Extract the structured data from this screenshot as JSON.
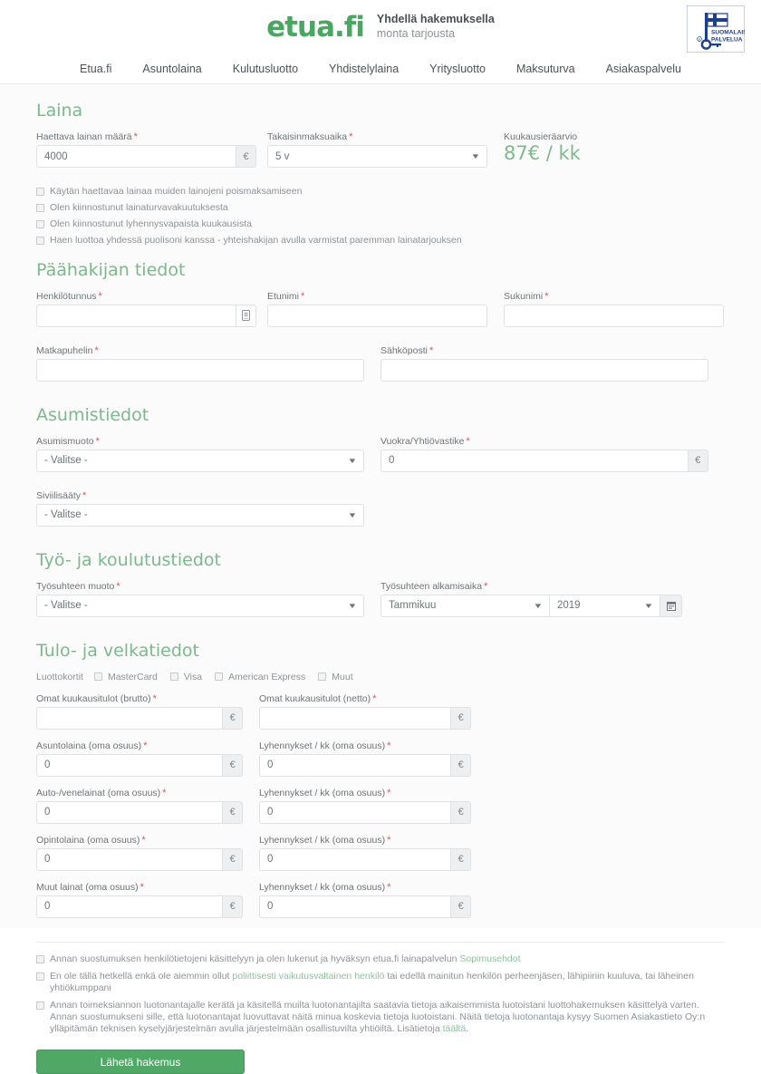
{
  "header": {
    "logo_text": "etua.fi",
    "tagline_line1": "Yhdellä hakemuksella",
    "tagline_line2": "monta tarjousta",
    "badge_line1": "SUOMALAISTA",
    "badge_line2": "PALVELUA"
  },
  "nav": {
    "items": [
      {
        "label": "Etua.fi"
      },
      {
        "label": "Asuntolaina"
      },
      {
        "label": "Kulutusluotto"
      },
      {
        "label": "Yhdistelylaina"
      },
      {
        "label": "Yritysluotto"
      },
      {
        "label": "Maksuturva"
      },
      {
        "label": "Asiakaspalvelu"
      }
    ]
  },
  "loan": {
    "title": "Laina",
    "amount_label": "Haettava lainan määrä",
    "amount_value": "4000",
    "amount_suffix": "€",
    "term_label": "Takaisinmaksuaika",
    "term_value": "5 v",
    "estimate_label": "Kuukausieräarvio",
    "estimate_value": "87€ / kk",
    "checkboxes": [
      {
        "label": "Käytän haettavaa lainaa muiden lainojeni poismaksamiseen",
        "checked": false
      },
      {
        "label": "Olen kiinnostunut lainaturvavakuutuksesta",
        "checked": false
      },
      {
        "label": "Olen kiinnostunut lyhennysvapaista kuukausista",
        "checked": false
      },
      {
        "label": "Haen luottoa yhdessä puolisoni kanssa - yhteishakijan avulla varmistat paremman lainatarjouksen",
        "checked": false
      }
    ]
  },
  "applicant": {
    "title": "Päähakijan tiedot",
    "ssn_label": "Henkilötunnus",
    "ssn_value": "",
    "firstname_label": "Etunimi",
    "firstname_value": "",
    "lastname_label": "Sukunimi",
    "lastname_value": "",
    "phone_label": "Matkapuhelin",
    "phone_value": "",
    "email_label": "Sähköposti",
    "email_value": ""
  },
  "housing": {
    "title": "Asumistiedot",
    "type_label": "Asumismuoto",
    "type_value": "- Valitse -",
    "rent_label": "Vuokra/Yhtiövastike",
    "rent_value": "0",
    "rent_suffix": "€",
    "marital_label": "Siviilisääty",
    "marital_value": "- Valitse -"
  },
  "work": {
    "title": "Työ- ja koulutustiedot",
    "employment_label": "Työsuhteen muoto",
    "employment_value": "- Valitse -",
    "start_label": "Työsuhteen alkamisaika",
    "start_month": "Tammikuu",
    "start_year": "2019"
  },
  "income": {
    "title": "Tulo- ja velkatiedot",
    "cards_caption": "Luottokortit",
    "cards": [
      {
        "label": "MasterCard",
        "checked": false
      },
      {
        "label": "Visa",
        "checked": false
      },
      {
        "label": "American Express",
        "checked": false
      },
      {
        "label": "Muut",
        "checked": false
      }
    ],
    "suffix": "€",
    "rows": [
      {
        "left_label": "Omat kuukausitulot (brutto)",
        "left_value": "",
        "right_label": "Omat kuukausitulot (netto)",
        "right_value": ""
      },
      {
        "left_label": "Asuntolaina (oma osuus)",
        "left_value": "0",
        "right_label": "Lyhennykset / kk (oma osuus)",
        "right_value": "0"
      },
      {
        "left_label": "Auto-/venelainat (oma osuus)",
        "left_value": "0",
        "right_label": "Lyhennykset / kk (oma osuus)",
        "right_value": "0"
      },
      {
        "left_label": "Opintolaina (oma osuus)",
        "left_value": "0",
        "right_label": "Lyhennykset / kk (oma osuus)",
        "right_value": "0"
      },
      {
        "left_label": "Muut lainat (oma osuus)",
        "left_value": "0",
        "right_label": "Lyhennykset / kk (oma osuus)",
        "right_value": "0"
      }
    ]
  },
  "consents": [
    {
      "text_before": "Annan suostumuksen henkilötietojeni käsittelyyn ja olen lukenut ja hyväksyn etua.fi lainapalvelun ",
      "link": "Sopimusehdot",
      "text_after": "",
      "checked": false
    },
    {
      "text_before": "En ole tällä hetkellä enkä ole aiemmin ollut ",
      "link": "poliittisesti vaikutusvaltainen henkilö",
      "text_after": " tai edellä mainitun henkilön perheenjäsen, lähipiiriin kuuluva, tai läheinen yhtiökumppani",
      "checked": false
    },
    {
      "text_before": "Annan toimeksiannon luotonantajalle kerätä ja käsitellä muilta luotonantajilta saatavia tietoja aikaisemmista luotoistani luottohakemuksen käsittelyä varten. Annan suostumukseni sille, että luotonantajat luovuttavat näitä minua koskevia tietoja luotoistani. Näitä tietoja luotonantaja kysyy Suomen Asiakastieto Oy:n ylläpitämän teknisen kyselyjärjestelmän avulla järjestelmään osallistuvilta yhtiöiltä. Lisätietoja ",
      "link": "täältä",
      "text_after": ".",
      "checked": false
    }
  ],
  "submit": {
    "label": "Lähetä hakemus"
  },
  "colors": {
    "brand_green": "#49a860",
    "heading_green": "#7cb98c",
    "button_green": "#4fa865",
    "required_red": "#e0505a",
    "badge_blue": "#1d3f8f"
  }
}
